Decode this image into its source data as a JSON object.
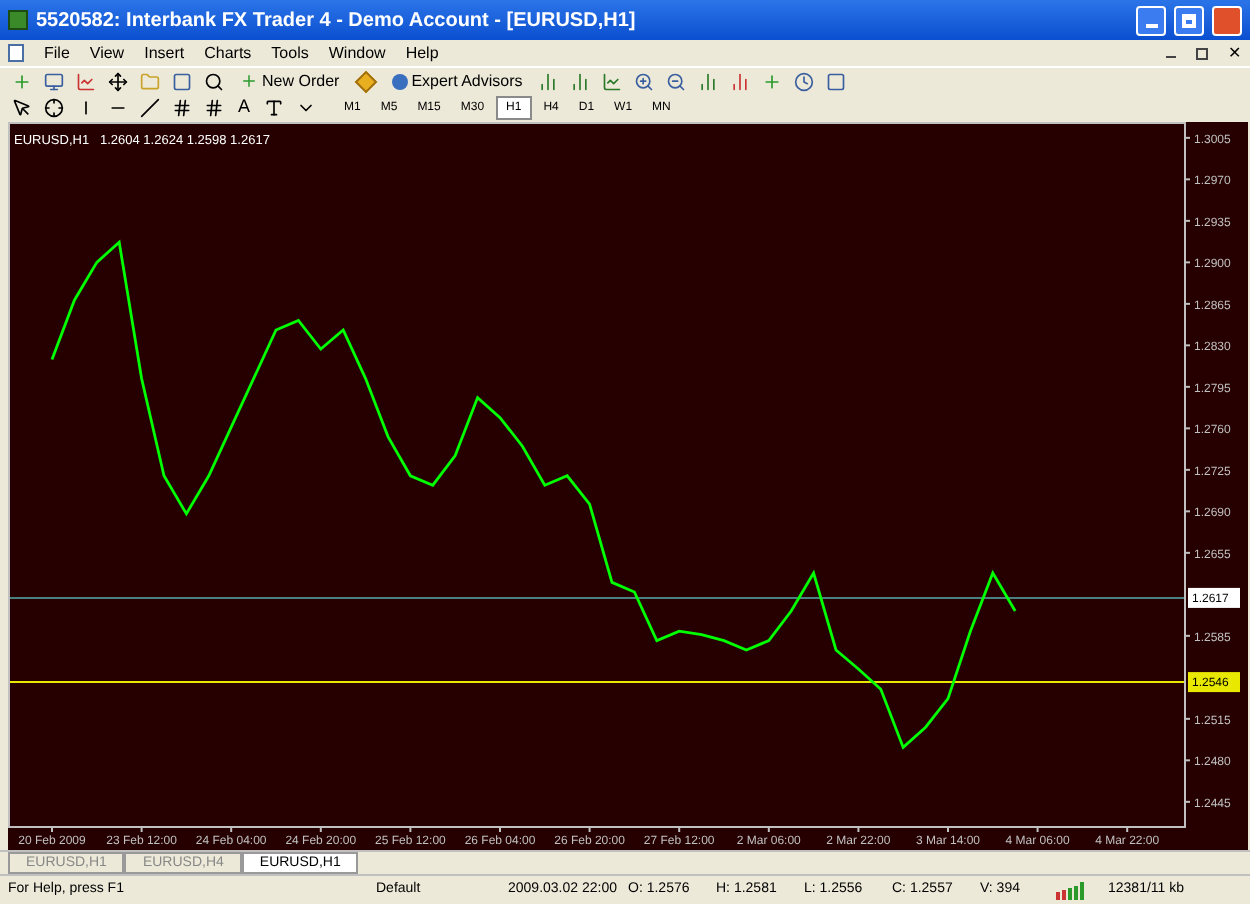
{
  "window": {
    "title": "5520582: Interbank FX Trader 4 - Demo Account - [EURUSD,H1]"
  },
  "menu": [
    "File",
    "View",
    "Insert",
    "Charts",
    "Tools",
    "Window",
    "Help"
  ],
  "mdi_close": "✕",
  "toolbar": {
    "buttons": [
      {
        "label": "New Order"
      },
      {
        "label": "Expert Advisors"
      }
    ]
  },
  "drawing_tools": {
    "text_tool": "A"
  },
  "timeframes": [
    {
      "label": "M1",
      "selected": false
    },
    {
      "label": "M5",
      "selected": false
    },
    {
      "label": "M15",
      "selected": false
    },
    {
      "label": "M30",
      "selected": false
    },
    {
      "label": "H1",
      "selected": true
    },
    {
      "label": "H4",
      "selected": false
    },
    {
      "label": "D1",
      "selected": false
    },
    {
      "label": "W1",
      "selected": false
    },
    {
      "label": "MN",
      "selected": false
    }
  ],
  "chart": {
    "symbol": "EURUSD,H1",
    "quote": "1.2604 1.2624 1.2598 1.2617",
    "chart_data": {
      "type": "line",
      "ylim": [
        1.2428,
        1.3015
      ],
      "yticks": [
        {
          "value": 1.3005,
          "label": "1.3005"
        },
        {
          "value": 1.297,
          "label": "1.2970"
        },
        {
          "value": 1.2935,
          "label": "1.2935"
        },
        {
          "value": 1.29,
          "label": "1.2900"
        },
        {
          "value": 1.2865,
          "label": "1.2865"
        },
        {
          "value": 1.283,
          "label": "1.2830"
        },
        {
          "value": 1.2795,
          "label": "1.2795"
        },
        {
          "value": 1.276,
          "label": "1.2760"
        },
        {
          "value": 1.2725,
          "label": "1.2725"
        },
        {
          "value": 1.269,
          "label": "1.2690"
        },
        {
          "value": 1.2655,
          "label": "1.2655"
        },
        {
          "value": 1.2585,
          "label": "1.2585"
        },
        {
          "value": 1.2515,
          "label": "1.2515"
        },
        {
          "value": 1.248,
          "label": "1.2480"
        },
        {
          "value": 1.2445,
          "label": "1.2445"
        }
      ],
      "categories": [
        "20 Feb 2009",
        null,
        null,
        null,
        "23 Feb 12:00",
        null,
        null,
        null,
        "24 Feb 04:00",
        null,
        null,
        null,
        "24 Feb 20:00",
        null,
        null,
        null,
        "25 Feb 12:00",
        null,
        null,
        null,
        "26 Feb 04:00",
        null,
        null,
        null,
        "26 Feb 20:00",
        null,
        null,
        null,
        "27 Feb 12:00",
        null,
        null,
        null,
        "2 Mar 06:00",
        null,
        null,
        null,
        "2 Mar 22:00",
        null,
        null,
        null,
        "3 Mar 14:00",
        null,
        null,
        null,
        "4 Mar 06:00",
        null,
        null,
        null,
        "4 Mar 22:00"
      ],
      "ref_lines": [
        {
          "axis": "y",
          "value": 1.2617,
          "label": "1.2617",
          "color": "#4a8080"
        },
        {
          "axis": "y",
          "value": 1.2546,
          "label": "1.2546",
          "color": "#e8e800"
        }
      ],
      "series": [
        {
          "color": "#00ff00",
          "values": [
            1.2818,
            1.2868,
            1.29,
            1.2917,
            1.2802,
            1.272,
            1.2688,
            1.272,
            1.2761,
            1.2802,
            1.2843,
            1.2851,
            1.2827,
            1.2843,
            1.2802,
            1.2753,
            1.272,
            1.2712,
            1.2737,
            1.2786,
            1.2769,
            1.2745,
            1.2712,
            1.272,
            1.2696,
            1.263,
            1.2622,
            1.2581,
            1.2589,
            1.2586,
            1.2581,
            1.2573,
            1.2581,
            1.2606,
            1.2638,
            1.2573,
            1.2557,
            1.254,
            1.2491,
            1.2508,
            1.2532,
            1.2589,
            1.2638,
            1.2606,
            null,
            null,
            null,
            null,
            null
          ]
        }
      ]
    }
  },
  "chart_tabs": [
    {
      "label": "EURUSD,H1",
      "selected": false
    },
    {
      "label": "EURUSD,H4",
      "selected": false
    },
    {
      "label": "EURUSD,H1",
      "selected": true
    }
  ],
  "status_bar": {
    "help": "For Help, press F1",
    "profile": "Default",
    "time": "2009.03.02 22:00",
    "open": "O: 1.2576",
    "high": "H: 1.2581",
    "low": "L: 1.2556",
    "close": "C: 1.2557",
    "volume": "V: 394",
    "traffic": "12381/11 kb"
  }
}
